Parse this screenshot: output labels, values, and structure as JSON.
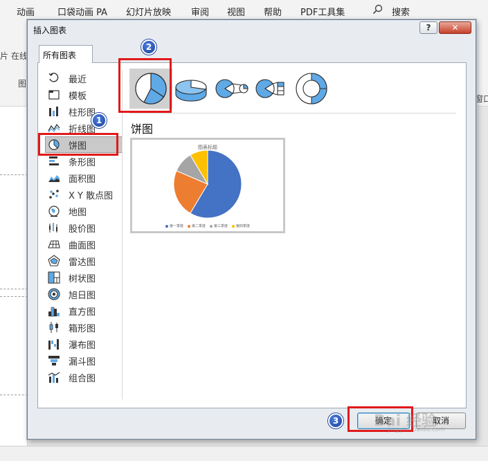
{
  "menubar": {
    "items": [
      "动画",
      "口袋动画 PA",
      "幻灯片放映",
      "审阅",
      "视图",
      "帮助",
      "PDF工具集"
    ],
    "search_label": "搜索"
  },
  "ribbon": {
    "fragment_left_1": "片",
    "fragment_left_2": "在线",
    "fragment_left_3": "图",
    "fragment_right": "窗口"
  },
  "dialog": {
    "title": "插入图表",
    "help_label": "?",
    "close_label": "✕",
    "tab_label": "所有图表",
    "categories": [
      {
        "label": "最近",
        "icon": "recent-icon"
      },
      {
        "label": "模板",
        "icon": "template-icon"
      },
      {
        "label": "柱形图",
        "icon": "column-chart-icon"
      },
      {
        "label": "折线图",
        "icon": "line-chart-icon"
      },
      {
        "label": "饼图",
        "icon": "pie-chart-icon",
        "selected": true
      },
      {
        "label": "条形图",
        "icon": "bar-chart-icon"
      },
      {
        "label": "面积图",
        "icon": "area-chart-icon"
      },
      {
        "label": "X Y 散点图",
        "icon": "scatter-chart-icon"
      },
      {
        "label": "地图",
        "icon": "map-chart-icon"
      },
      {
        "label": "股价图",
        "icon": "stock-chart-icon"
      },
      {
        "label": "曲面图",
        "icon": "surface-chart-icon"
      },
      {
        "label": "雷达图",
        "icon": "radar-chart-icon"
      },
      {
        "label": "树状图",
        "icon": "treemap-chart-icon"
      },
      {
        "label": "旭日图",
        "icon": "sunburst-chart-icon"
      },
      {
        "label": "直方图",
        "icon": "histogram-chart-icon"
      },
      {
        "label": "箱形图",
        "icon": "boxwhisker-chart-icon"
      },
      {
        "label": "瀑布图",
        "icon": "waterfall-chart-icon"
      },
      {
        "label": "漏斗图",
        "icon": "funnel-chart-icon"
      },
      {
        "label": "组合图",
        "icon": "combo-chart-icon"
      }
    ],
    "subtypes": [
      {
        "name": "pie",
        "selected": true
      },
      {
        "name": "3d-pie",
        "selected": false
      },
      {
        "name": "pie-of-pie",
        "selected": false
      },
      {
        "name": "bar-of-pie",
        "selected": false
      },
      {
        "name": "doughnut",
        "selected": false
      }
    ],
    "type_heading": "饼图",
    "preview": {
      "title": "图表标题",
      "legend": [
        "第一季度",
        "第二季度",
        "第三季度",
        "第四季度"
      ]
    },
    "ok_label": "确定",
    "cancel_label": "取消"
  },
  "chart_data": {
    "type": "pie",
    "title": "图表标题",
    "categories": [
      "第一季度",
      "第二季度",
      "第三季度",
      "第四季度"
    ],
    "values": [
      8.2,
      3.2,
      1.4,
      1.2
    ],
    "colors": [
      "#4472c4",
      "#ed7d31",
      "#a5a5a5",
      "#ffc000"
    ],
    "legend_position": "bottom"
  },
  "annotations": {
    "badge_1": "1",
    "badge_2": "2",
    "badge_3": "3"
  },
  "watermark": {
    "main": "Bai 经验",
    "sub": "jingyan.baidu.com"
  }
}
